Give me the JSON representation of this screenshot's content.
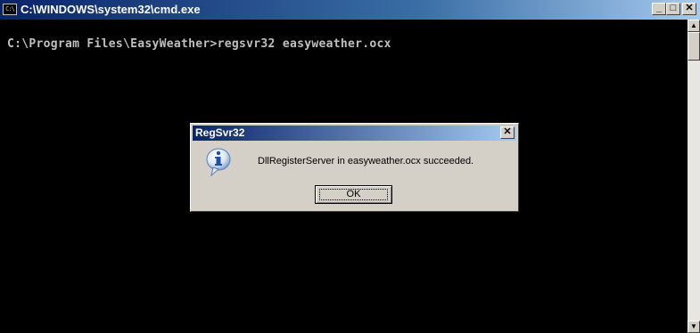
{
  "window": {
    "title": "C:\\WINDOWS\\system32\\cmd.exe",
    "icon_label": "C:\\",
    "minimize_glyph": "_",
    "maximize_glyph": "□",
    "close_glyph": "✕"
  },
  "console": {
    "prompt_line": "C:\\Program Files\\EasyWeather>regsvr32 easyweather.ocx"
  },
  "scrollbar": {
    "up_glyph": "▲",
    "down_glyph": "▼"
  },
  "dialog": {
    "title": "RegSvr32",
    "close_glyph": "✕",
    "message": "DllRegisterServer in easyweather.ocx succeeded.",
    "ok_label": "OK",
    "icon": "information-icon"
  },
  "colors": {
    "console_background": "#000000",
    "console_text": "#c0c0c0",
    "titlebar_active": "#0a246a",
    "dialog_face": "#d4d0c8"
  }
}
